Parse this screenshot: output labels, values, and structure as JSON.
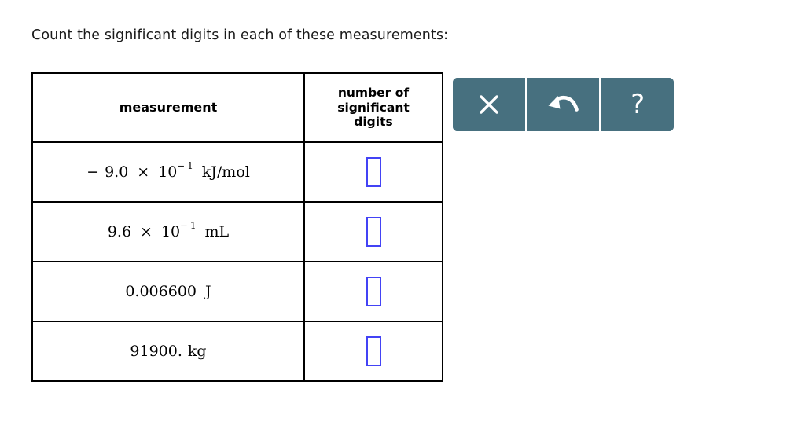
{
  "prompt": "Count the significant digits in each of these measurements:",
  "table": {
    "headers": {
      "measurement": "measurement",
      "sig_digits_line1": "number of",
      "sig_digits_line2": "significant",
      "sig_digits_line3": "digits"
    },
    "rows": [
      {
        "sign": "−",
        "coefficient": "9.0",
        "times": "×",
        "base": "10",
        "exponent_sign": "−",
        "exponent": "1",
        "unit": "kJ/mol",
        "answer_value": "",
        "answer_placeholder": ""
      },
      {
        "sign": "",
        "coefficient": "9.6",
        "times": "×",
        "base": "10",
        "exponent_sign": "−",
        "exponent": "1",
        "unit": "mL",
        "answer_value": "",
        "answer_placeholder": ""
      },
      {
        "sign": "",
        "coefficient": "0.006600",
        "times": "",
        "base": "",
        "exponent_sign": "",
        "exponent": "",
        "unit": "J",
        "answer_value": "",
        "answer_placeholder": ""
      },
      {
        "sign": "",
        "coefficient": "91900.",
        "times": "",
        "base": "",
        "exponent_sign": "",
        "exponent": "",
        "unit": "kg",
        "answer_value": "",
        "answer_placeholder": ""
      }
    ]
  },
  "toolbar": {
    "background_color": "#47707f",
    "buttons": [
      {
        "name": "clear",
        "icon": "close-x-icon",
        "label": ""
      },
      {
        "name": "undo",
        "icon": "undo-arrow-icon",
        "label": ""
      },
      {
        "name": "help",
        "icon": "question-mark-icon",
        "label": "?"
      }
    ]
  },
  "colors": {
    "input_border": "#4343f5",
    "table_border": "#000000",
    "text": "#000000",
    "toolbar": "#47707f"
  }
}
